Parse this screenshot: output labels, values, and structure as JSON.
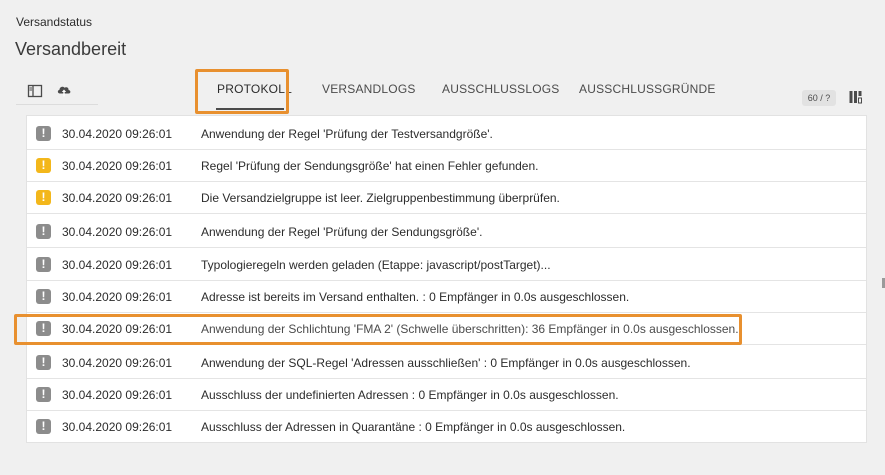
{
  "header": {
    "status_label": "Versandstatus",
    "title": "Versandbereit"
  },
  "toolbar": {
    "icons": [
      "sidebar-toggle-icon",
      "cloud-upload-icon"
    ],
    "count_badge": "60 / ?",
    "columns_icon": "columns-settings-icon"
  },
  "tabs": [
    {
      "label": "PROTOKOLL",
      "active": true
    },
    {
      "label": "VERSANDLOGS",
      "active": false
    },
    {
      "label": "AUSSCHLUSSLOGS",
      "active": false
    },
    {
      "label": "AUSSCHLUSSGRÜNDE",
      "active": false
    }
  ],
  "logs": [
    {
      "type": "info",
      "date": "30.04.2020 09:26:01",
      "message": "Anwendung der Regel 'Prüfung der Testversandgröße'."
    },
    {
      "type": "warning",
      "date": "30.04.2020 09:26:01",
      "message": "Regel 'Prüfung der Sendungsgröße' hat einen Fehler gefunden."
    },
    {
      "type": "warning",
      "date": "30.04.2020 09:26:01",
      "message": "Die Versandzielgruppe ist leer. Zielgruppenbestimmung überprüfen."
    },
    {
      "type": "info",
      "date": "30.04.2020 09:26:01",
      "message": "Anwendung der Regel 'Prüfung der Sendungsgröße'."
    },
    {
      "type": "info",
      "date": "30.04.2020 09:26:01",
      "message": "Typologieregeln werden geladen (Etappe: javascript/postTarget)..."
    },
    {
      "type": "info",
      "date": "30.04.2020 09:26:01",
      "message": "Adresse ist bereits im Versand enthalten. : 0 Empfänger in 0.0s ausgeschlossen."
    },
    {
      "type": "info",
      "date": "30.04.2020 09:26:01",
      "message": "Anwendung der Schlichtung 'FMA 2' (Schwelle überschritten): 36 Empfänger in 0.0s ausgeschlossen."
    },
    {
      "type": "info",
      "date": "30.04.2020 09:26:01",
      "message": "Anwendung der SQL-Regel 'Adressen ausschließen' : 0 Empfänger in 0.0s ausgeschlossen."
    },
    {
      "type": "info",
      "date": "30.04.2020 09:26:01",
      "message": "Ausschluss der undefinierten Adressen : 0 Empfänger in 0.0s ausgeschlossen."
    },
    {
      "type": "info",
      "date": "30.04.2020 09:26:01",
      "message": "Ausschluss der Adressen in Quarantäne : 0 Empfänger in 0.0s ausgeschlossen."
    }
  ],
  "colors": {
    "highlight": "#e8902f",
    "warning": "#f3b71b",
    "info": "#8c8c8c",
    "background": "#f0f0f0"
  }
}
